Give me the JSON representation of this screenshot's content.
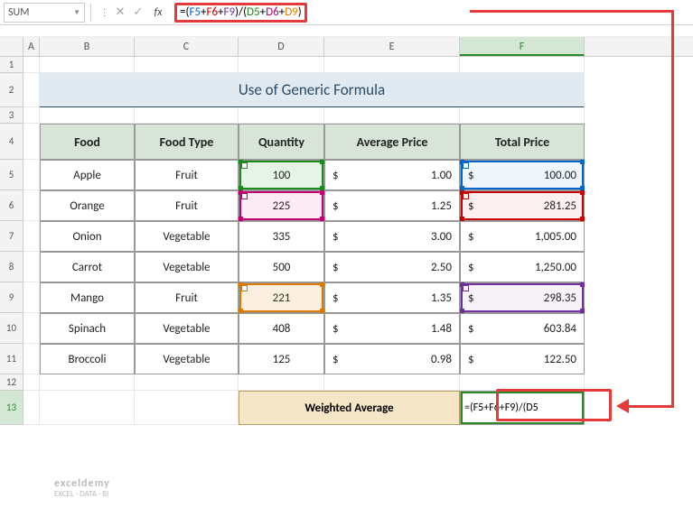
{
  "namebox": {
    "value": "SUM"
  },
  "formula_bar": {
    "parts": [
      {
        "t": "=",
        "cls": "c-eq"
      },
      {
        "t": "(",
        "cls": "c-paren"
      },
      {
        "t": "F5",
        "cls": "c-blue"
      },
      {
        "t": "+",
        "cls": "c-eq"
      },
      {
        "t": "F6",
        "cls": "c-red"
      },
      {
        "t": "+",
        "cls": "c-eq"
      },
      {
        "t": "F9",
        "cls": "c-purple"
      },
      {
        "t": ")",
        "cls": "c-paren"
      },
      {
        "t": "/",
        "cls": "c-eq"
      },
      {
        "t": "(",
        "cls": "c-paren"
      },
      {
        "t": "D5",
        "cls": "c-green"
      },
      {
        "t": "+",
        "cls": "c-eq"
      },
      {
        "t": "D6",
        "cls": "c-pink"
      },
      {
        "t": "+",
        "cls": "c-eq"
      },
      {
        "t": "D9",
        "cls": "c-orange"
      },
      {
        "t": ")",
        "cls": "c-paren"
      }
    ]
  },
  "columns": [
    "A",
    "B",
    "C",
    "D",
    "E",
    "F"
  ],
  "title": "Use of Generic Formula",
  "headers": {
    "food": "Food",
    "type": "Food Type",
    "qty": "Quantity",
    "avg": "Average Price",
    "total": "Total Price"
  },
  "rows": [
    {
      "food": "Apple",
      "type": "Fruit",
      "qty": "100",
      "avg": "1.00",
      "total": "100.00"
    },
    {
      "food": "Orange",
      "type": "Fruit",
      "qty": "225",
      "avg": "1.25",
      "total": "281.25"
    },
    {
      "food": "Onion",
      "type": "Vegetable",
      "qty": "335",
      "avg": "3.00",
      "total": "1,005.00"
    },
    {
      "food": "Carrot",
      "type": "Vegetable",
      "qty": "500",
      "avg": "2.50",
      "total": "1,250.00"
    },
    {
      "food": "Mango",
      "type": "Fruit",
      "qty": "221",
      "avg": "1.35",
      "total": "298.35"
    },
    {
      "food": "Spinach",
      "type": "Vegetable",
      "qty": "408",
      "avg": "1.48",
      "total": "603.84"
    },
    {
      "food": "Broccoli",
      "type": "Vegetable",
      "qty": "125",
      "avg": "0.98",
      "total": "122.50"
    }
  ],
  "currency": "$",
  "weighted_avg_label": "Weighted Average",
  "result_formula_display": "=(F5+F6+F9)/(D5",
  "watermark": {
    "brand": "exceldemy",
    "tag": "EXCEL · DATA · BI"
  }
}
